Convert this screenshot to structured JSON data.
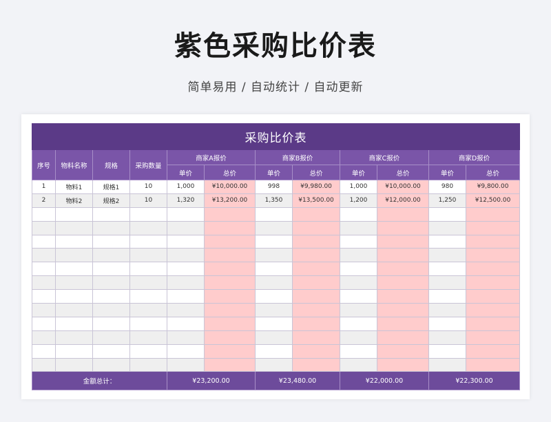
{
  "header": {
    "title": "紫色采购比价表",
    "subtitle": "简单易用  /  自动统计  /  自动更新"
  },
  "sheet": {
    "title": "采购比价表",
    "col_headers": {
      "seq": "序号",
      "name": "物料名称",
      "spec": "规格",
      "qty": "采购数量",
      "vendors": [
        "商家A报价",
        "商家B报价",
        "商家C报价",
        "商家D报价"
      ],
      "unit_price": "单价",
      "total": "总价"
    },
    "rows": [
      {
        "seq": "1",
        "name": "物料1",
        "spec": "规格1",
        "qty": "10",
        "quotes": [
          {
            "unit": "1,000",
            "total": "¥10,000.00"
          },
          {
            "unit": "998",
            "total": "¥9,980.00"
          },
          {
            "unit": "1,000",
            "total": "¥10,000.00"
          },
          {
            "unit": "980",
            "total": "¥9,800.00"
          }
        ]
      },
      {
        "seq": "2",
        "name": "物料2",
        "spec": "规格2",
        "qty": "10",
        "quotes": [
          {
            "unit": "1,320",
            "total": "¥13,200.00"
          },
          {
            "unit": "1,350",
            "total": "¥13,500.00"
          },
          {
            "unit": "1,200",
            "total": "¥12,000.00"
          },
          {
            "unit": "1,250",
            "total": "¥12,500.00"
          }
        ]
      }
    ],
    "footer": {
      "label": "金额总计：",
      "totals": [
        "¥23,200.00",
        "¥23,480.00",
        "¥22,000.00",
        "¥22,300.00"
      ]
    }
  }
}
